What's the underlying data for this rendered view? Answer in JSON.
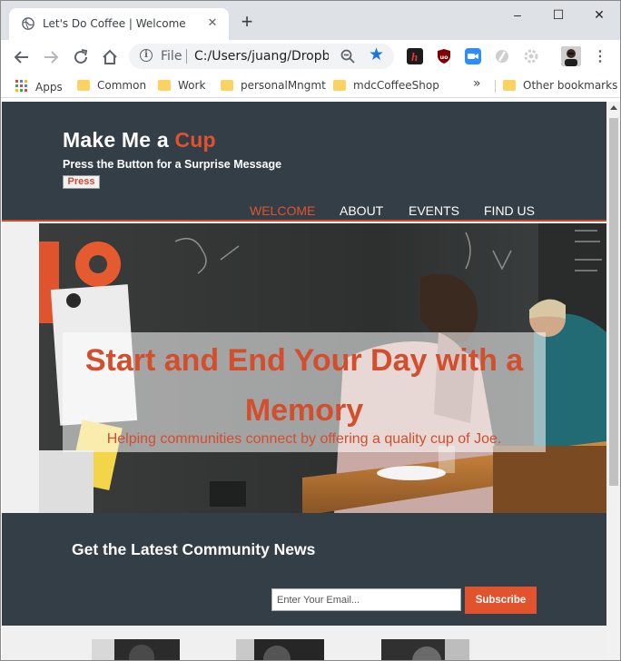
{
  "browser": {
    "tab_title": "Let's Do Coffee | Welcome",
    "new_tab_label": "+",
    "window_controls": {
      "minimize": "–",
      "maximize": "☐",
      "close": "✕"
    },
    "address": {
      "scheme_label": "File",
      "url": "C:/Users/juang/Dropbox/"
    },
    "bookmarks": {
      "apps": "Apps",
      "items": [
        "Common",
        "Work",
        "personalMngmt",
        "mdcCoffeeShop"
      ],
      "overflow": "»",
      "other": "Other bookmarks"
    }
  },
  "site": {
    "brand_main": "Make Me a ",
    "brand_accent": "Cup",
    "tagline": "Press the Button for a Surprise Message",
    "press_label": "Press",
    "nav": [
      "WELCOME",
      "ABOUT",
      "EVENTS",
      "FIND US"
    ],
    "active_nav": "WELCOME",
    "hero": {
      "title": "Start and End Your Day with a Memory",
      "subtitle": "Helping communities connect by offering a quality cup of Joe."
    },
    "newsletter": {
      "title": "Get the Latest Community News",
      "email_placeholder": "Enter Your Email...",
      "subscribe_label": "Subscribe"
    }
  },
  "colors": {
    "accent": "#e0532d",
    "header_bg": "#343e46",
    "chrome_tabbar": "#dee1e6",
    "link_blue": "#1a73e8"
  }
}
